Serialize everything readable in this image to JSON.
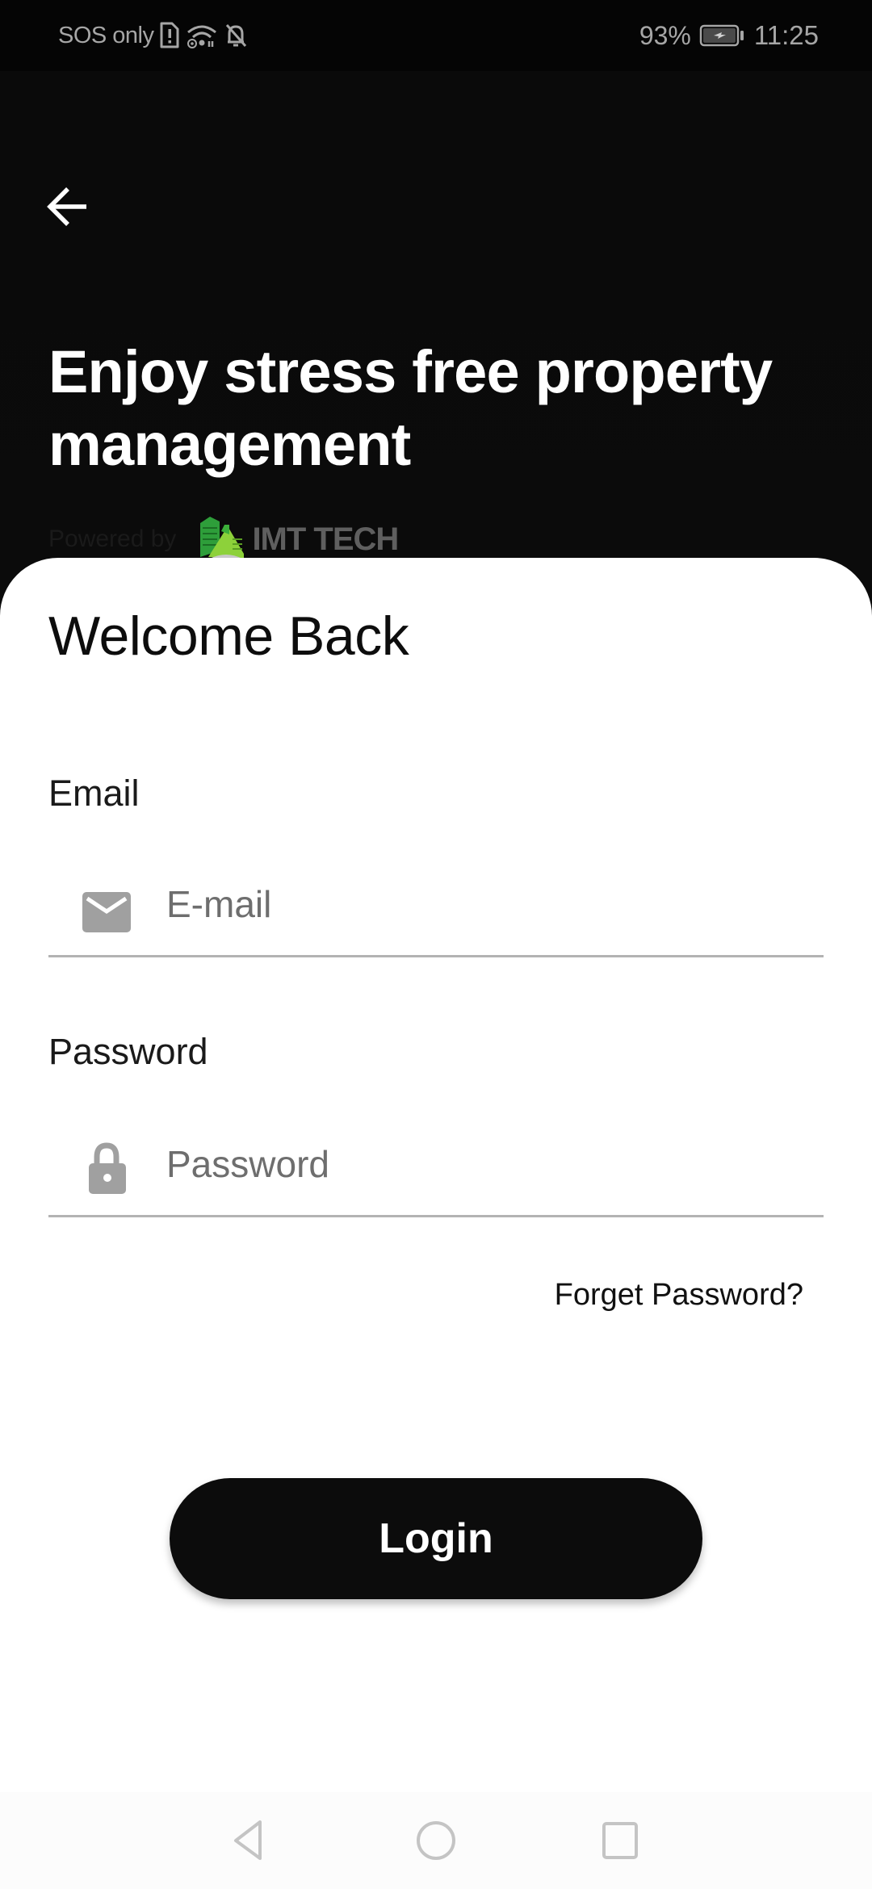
{
  "status_bar": {
    "carrier_text": "SOS only",
    "icons": [
      "sim-alert-icon",
      "wifi-icon",
      "notifications-off-icon",
      "battery-charging-icon"
    ],
    "battery_percent": "93%",
    "time": "11:25"
  },
  "header": {
    "back_icon": "arrow-left-icon",
    "headline": "Enjoy stress free property management",
    "powered_by_label": "Powered by",
    "brand_name": "IMT TECH",
    "brand_colors": {
      "green_dark": "#2e9e3a",
      "green_light": "#8dd13a",
      "text": "#5f5f5f"
    }
  },
  "form": {
    "title": "Welcome Back",
    "email": {
      "label": "Email",
      "placeholder": "E-mail",
      "value": "",
      "icon": "mail-icon"
    },
    "password": {
      "label": "Password",
      "placeholder": "Password",
      "value": "",
      "icon": "lock-icon"
    },
    "forgot_link": "Forget Password?",
    "login_button": "Login"
  },
  "nav_bar": {
    "buttons": [
      "back-nav",
      "home-nav",
      "recents-nav"
    ]
  },
  "colors": {
    "header_bg": "#0b0b0b",
    "card_bg": "#ffffff",
    "primary_button": "#0c0c0c",
    "icon_gray": "#a0a0a0",
    "underline": "#b3b3b3"
  }
}
